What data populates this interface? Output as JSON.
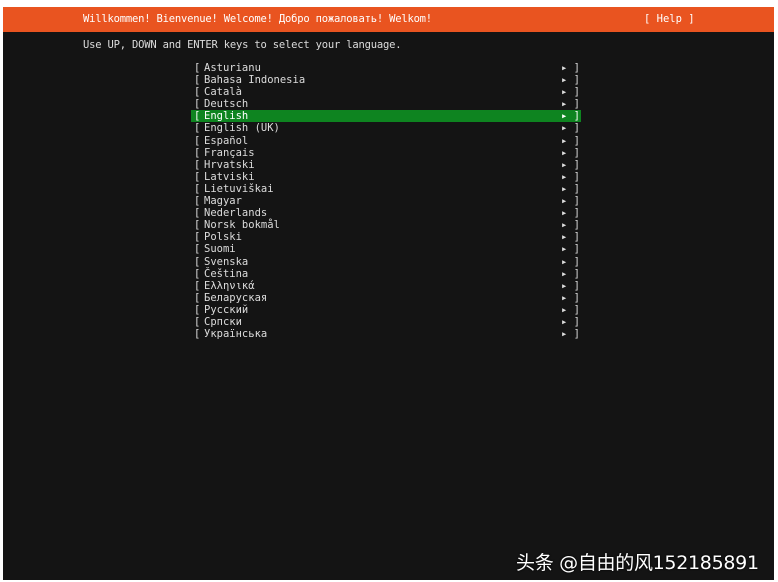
{
  "header": {
    "title": "Willkommen! Bienvenue! Welcome! Добро пожаловать! Welkom!",
    "help_label": "[ Help ]"
  },
  "instruction": "Use UP, DOWN and ENTER keys to select your language.",
  "list": {
    "open_bracket": "[",
    "close_marker": "▸ ]",
    "selected_index": 4,
    "items": [
      "Asturianu",
      "Bahasa Indonesia",
      "Català",
      "Deutsch",
      "English",
      "English (UK)",
      "Español",
      "Français",
      "Hrvatski",
      "Latviski",
      "Lietuviškai",
      "Magyar",
      "Nederlands",
      "Norsk bokmål",
      "Polski",
      "Suomi",
      "Svenska",
      "Čeština",
      "Ελληνικά",
      "Беларуская",
      "Русский",
      "Српски",
      "Українська"
    ]
  },
  "watermark": "头条 @自由的风152185891",
  "colors": {
    "header_bg": "#e95420",
    "selected_bg": "#0e8420",
    "screen_bg": "#141414"
  }
}
